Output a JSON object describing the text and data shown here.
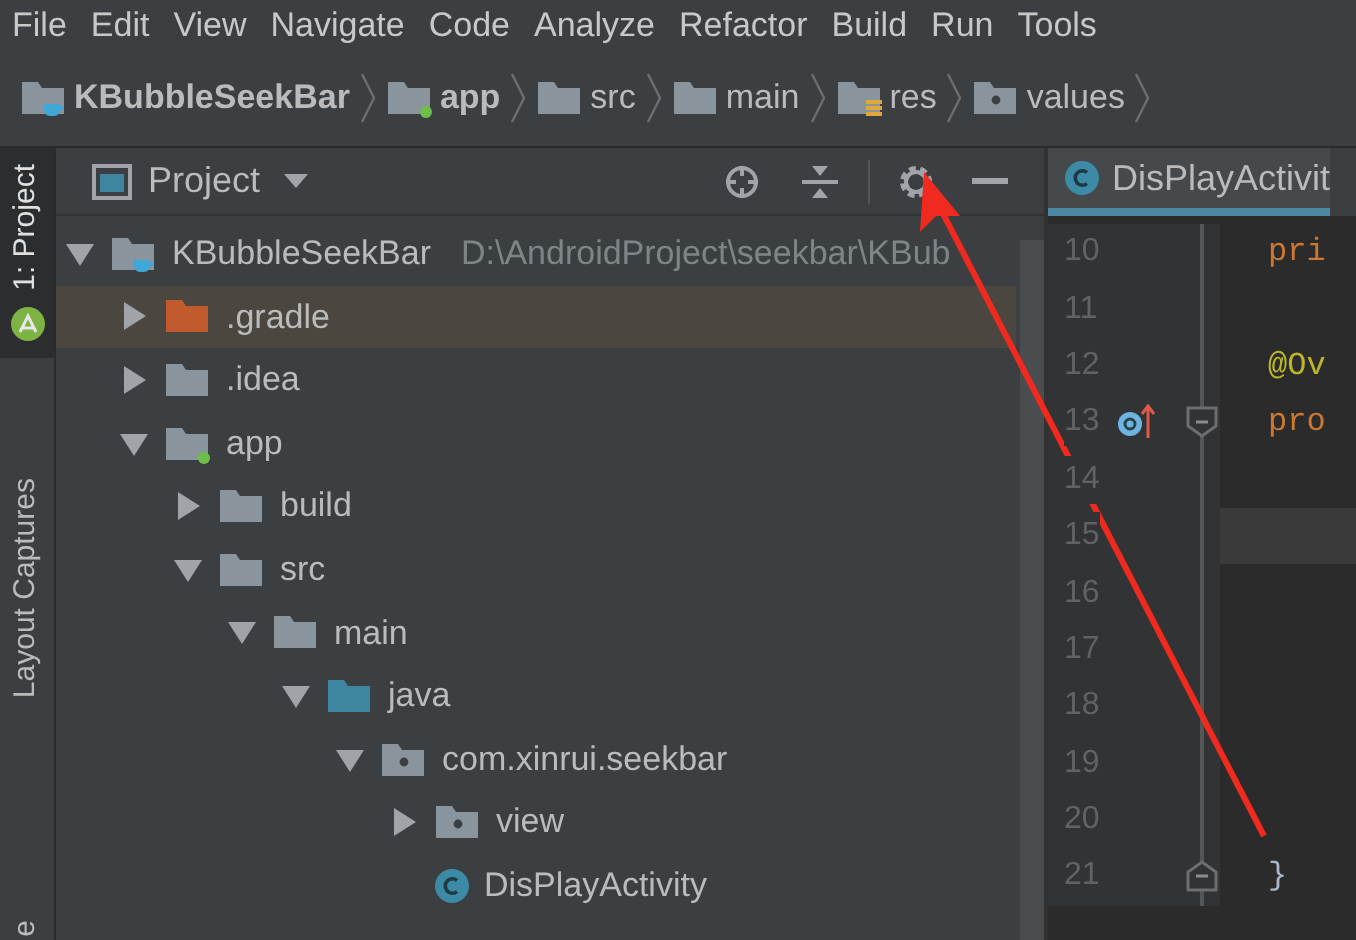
{
  "menu": [
    {
      "label": "File"
    },
    {
      "label": "Edit"
    },
    {
      "label": "View"
    },
    {
      "label": "Navigate"
    },
    {
      "label": "Code"
    },
    {
      "label": "Analyze"
    },
    {
      "label": "Refactor"
    },
    {
      "label": "Build"
    },
    {
      "label": "Run"
    },
    {
      "label": "Tools"
    }
  ],
  "breadcrumbs": [
    {
      "label": "KBubbleSeekBar",
      "kind": "project",
      "bold": true
    },
    {
      "label": "app",
      "kind": "module",
      "bold": true
    },
    {
      "label": "src",
      "kind": "folder",
      "bold": false
    },
    {
      "label": "main",
      "kind": "folder",
      "bold": false
    },
    {
      "label": "res",
      "kind": "resources",
      "bold": false
    },
    {
      "label": "values",
      "kind": "package",
      "bold": false
    }
  ],
  "side_strip": [
    {
      "label": "1: Project",
      "kind": "tab",
      "selected": true
    },
    {
      "kind": "android"
    },
    {
      "label": "Layout Captures",
      "kind": "tab",
      "selected": false
    },
    {
      "label": "e",
      "kind": "tab",
      "selected": false
    }
  ],
  "project_panel": {
    "title": "Project",
    "tree": [
      {
        "label": "KBubbleSeekBar",
        "path": "D:\\AndroidProject\\seekbar\\KBub",
        "kind": "project",
        "expanded": true,
        "highlighted": false,
        "children": [
          {
            "label": ".gradle",
            "kind": "excluded",
            "expanded": false,
            "highlighted": true
          },
          {
            "label": ".idea",
            "kind": "folder",
            "expanded": false,
            "highlighted": false
          },
          {
            "label": "app",
            "kind": "module",
            "expanded": true,
            "highlighted": false,
            "children": [
              {
                "label": "build",
                "kind": "folder",
                "expanded": false,
                "highlighted": false
              },
              {
                "label": "src",
                "kind": "folder",
                "expanded": true,
                "highlighted": false,
                "children": [
                  {
                    "label": "main",
                    "kind": "folder",
                    "expanded": true,
                    "highlighted": false,
                    "children": [
                      {
                        "label": "java",
                        "kind": "source",
                        "expanded": true,
                        "highlighted": false,
                        "children": [
                          {
                            "label": "com.xinrui.seekbar",
                            "kind": "package",
                            "expanded": true,
                            "highlighted": false,
                            "children": [
                              {
                                "label": "view",
                                "kind": "package",
                                "expanded": false,
                                "highlighted": false
                              },
                              {
                                "label": "DisPlayActivity",
                                "kind": "class",
                                "highlighted": false
                              }
                            ]
                          }
                        ]
                      }
                    ]
                  }
                ]
              }
            ]
          }
        ]
      }
    ]
  },
  "editor": {
    "tab": {
      "label": "DisPlayActivit",
      "selected": true
    },
    "lines": [
      {
        "number": "10",
        "code": "pri",
        "kind": "keyword",
        "overrides": false,
        "fold_start": false,
        "fold_end": false,
        "current": false
      },
      {
        "number": "11",
        "overrides": false,
        "fold_start": false,
        "fold_end": false,
        "current": false
      },
      {
        "number": "12",
        "code": "@Ov",
        "kind": "annotation",
        "overrides": false,
        "fold_start": false,
        "fold_end": false,
        "current": false
      },
      {
        "number": "13",
        "code": "pro",
        "kind": "keyword",
        "overrides": true,
        "fold_start": true,
        "fold_end": false,
        "current": false
      },
      {
        "number": "14",
        "overrides": false,
        "fold_start": false,
        "fold_end": false,
        "current": false
      },
      {
        "number": "15",
        "overrides": false,
        "fold_start": false,
        "fold_end": false,
        "current": true
      },
      {
        "number": "16",
        "overrides": false,
        "fold_start": false,
        "fold_end": false,
        "current": false
      },
      {
        "number": "17",
        "overrides": false,
        "fold_start": false,
        "fold_end": false,
        "current": false
      },
      {
        "number": "18",
        "overrides": false,
        "fold_start": false,
        "fold_end": false,
        "current": false
      },
      {
        "number": "19",
        "overrides": false,
        "fold_start": false,
        "fold_end": false,
        "current": false
      },
      {
        "number": "20",
        "overrides": false,
        "fold_start": false,
        "fold_end": false,
        "current": false
      },
      {
        "number": "21",
        "code": "}",
        "kind": "plain",
        "overrides": false,
        "fold_start": false,
        "fold_end": true,
        "current": false
      }
    ]
  }
}
